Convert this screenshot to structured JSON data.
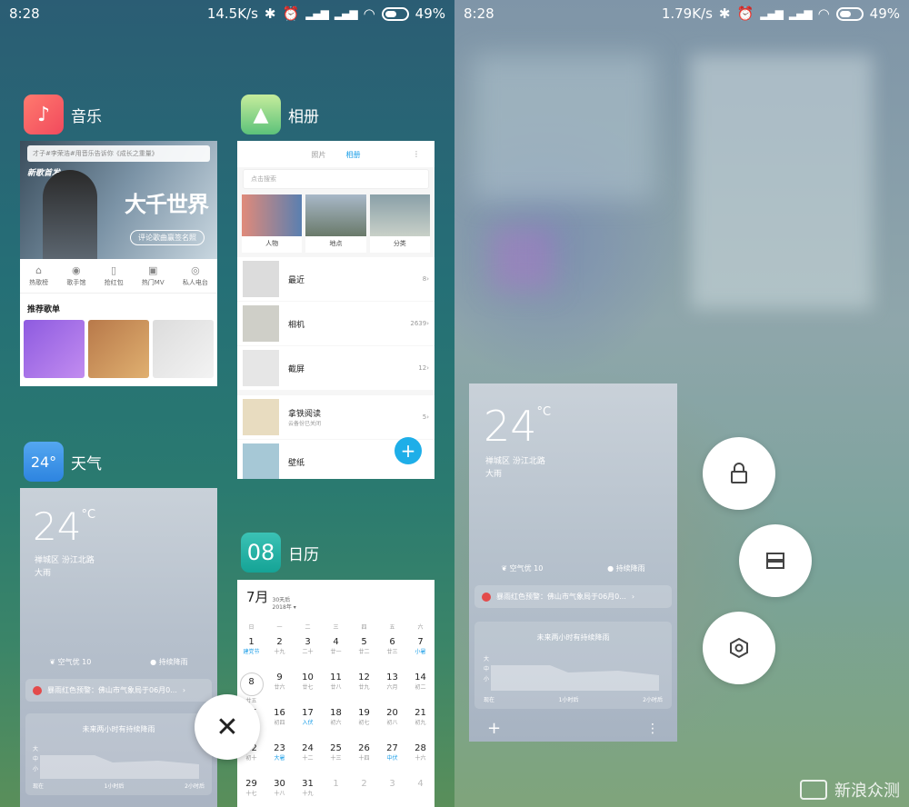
{
  "left": {
    "status": {
      "time": "8:28",
      "speed": "14.5K/s",
      "battery": "49%"
    },
    "music": {
      "app_name": "音乐",
      "search_placeholder": "才子#李荣浩#用音乐告诉你《成长之重量》",
      "banner_tag": "新歌首发",
      "banner_title": "大千世界",
      "banner_button": "评论歌曲赢签名照",
      "nav": [
        "热歌榜",
        "歌手馆",
        "抢红包",
        "热门MV",
        "私人电台"
      ],
      "section_title": "推荐歌单"
    },
    "gallery": {
      "app_name": "相册",
      "tabs": [
        "照片",
        "相册"
      ],
      "search_placeholder": "点击搜索",
      "categories": [
        "人物",
        "地点",
        "分类"
      ],
      "albums": [
        {
          "name": "最近",
          "sub": "",
          "count": "8"
        },
        {
          "name": "相机",
          "sub": "",
          "count": "2639"
        },
        {
          "name": "截屏",
          "sub": "",
          "count": "12"
        },
        {
          "name": "拿铁阅读",
          "sub": "云备份已关闭",
          "count": "5"
        },
        {
          "name": "壁纸",
          "sub": "",
          "count": ""
        }
      ],
      "fab": "+"
    },
    "weather": {
      "app_name": "天气",
      "icon_text": "24°",
      "temp": "24",
      "unit": "°C",
      "location": "禅城区 汾江北路",
      "condition": "大雨",
      "aqi": "空气优 10",
      "rain": "持续降雨",
      "alert": "暴雨红色预警：佛山市气象局于06月0...",
      "forecast_title": "未来两小时有持续降雨",
      "axis": [
        "现在",
        "1小时后",
        "2小时后"
      ],
      "axis_levels": [
        "大",
        "中",
        "小"
      ]
    },
    "calendar": {
      "app_name": "日历",
      "icon_text": "08",
      "month": "7月",
      "meta_days": "30天后",
      "meta_year": "2018年",
      "weekdays": [
        "日",
        "一",
        "二",
        "三",
        "四",
        "五",
        "六"
      ],
      "weeks": [
        [
          [
            "1",
            "建党节",
            "blue"
          ],
          [
            "2",
            "十九",
            ""
          ],
          [
            "3",
            "二十",
            ""
          ],
          [
            "4",
            "廿一",
            ""
          ],
          [
            "5",
            "廿二",
            ""
          ],
          [
            "6",
            "廿三",
            ""
          ],
          [
            "7",
            "小暑",
            "blue"
          ]
        ],
        [
          [
            "8",
            "廿五",
            "today"
          ],
          [
            "9",
            "廿六",
            ""
          ],
          [
            "10",
            "廿七",
            ""
          ],
          [
            "11",
            "廿八",
            ""
          ],
          [
            "12",
            "廿九",
            ""
          ],
          [
            "13",
            "六月",
            ""
          ],
          [
            "14",
            "初二",
            ""
          ]
        ],
        [
          [
            "15",
            "初三",
            ""
          ],
          [
            "16",
            "初四",
            ""
          ],
          [
            "17",
            "入伏",
            "blue"
          ],
          [
            "18",
            "初六",
            ""
          ],
          [
            "19",
            "初七",
            ""
          ],
          [
            "20",
            "初八",
            ""
          ],
          [
            "21",
            "初九",
            ""
          ]
        ],
        [
          [
            "22",
            "初十",
            ""
          ],
          [
            "23",
            "大暑",
            "blue"
          ],
          [
            "24",
            "十二",
            ""
          ],
          [
            "25",
            "十三",
            ""
          ],
          [
            "26",
            "十四",
            ""
          ],
          [
            "27",
            "中伏",
            "blue"
          ],
          [
            "28",
            "十六",
            ""
          ]
        ],
        [
          [
            "29",
            "十七",
            ""
          ],
          [
            "30",
            "十八",
            ""
          ],
          [
            "31",
            "十九",
            ""
          ],
          [
            "1",
            "",
            "faded"
          ],
          [
            "2",
            "",
            "faded"
          ],
          [
            "3",
            "",
            "faded"
          ],
          [
            "4",
            "",
            "faded"
          ]
        ]
      ]
    },
    "close_label": "✕"
  },
  "right": {
    "status": {
      "time": "8:28",
      "speed": "1.79K/s",
      "battery": "49%"
    },
    "weather": {
      "temp": "24",
      "unit": "°C",
      "location": "禅城区 汾江北路",
      "condition": "大雨",
      "aqi": "空气优 10",
      "rain": "持续降雨",
      "alert": "暴雨红色预警：佛山市气象局于06月0...",
      "forecast_title": "未来两小时有持续降雨",
      "axis": [
        "现在",
        "1小时后",
        "2小时后"
      ],
      "axis_levels": [
        "大",
        "中",
        "小"
      ],
      "add": "+",
      "more": "⋮"
    },
    "actions": [
      "lock-icon",
      "split-screen-icon",
      "settings-icon"
    ],
    "watermark": "新浪众测"
  }
}
